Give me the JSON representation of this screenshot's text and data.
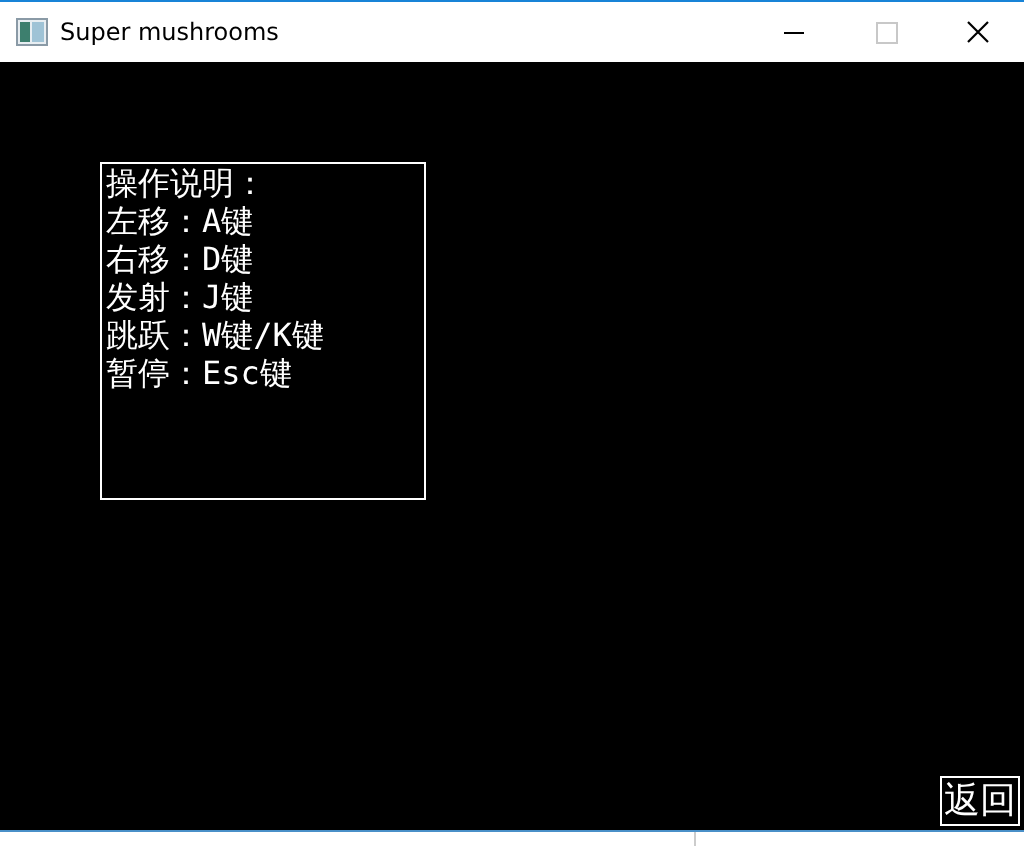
{
  "window": {
    "title": "Super mushrooms"
  },
  "instructions": {
    "heading": "操作说明：",
    "lines": [
      "左移：A键",
      "右移：D键",
      "发射：J键",
      "跳跃：W键/K键",
      "暂停：Esc键"
    ]
  },
  "back_button": {
    "label": "返回"
  }
}
